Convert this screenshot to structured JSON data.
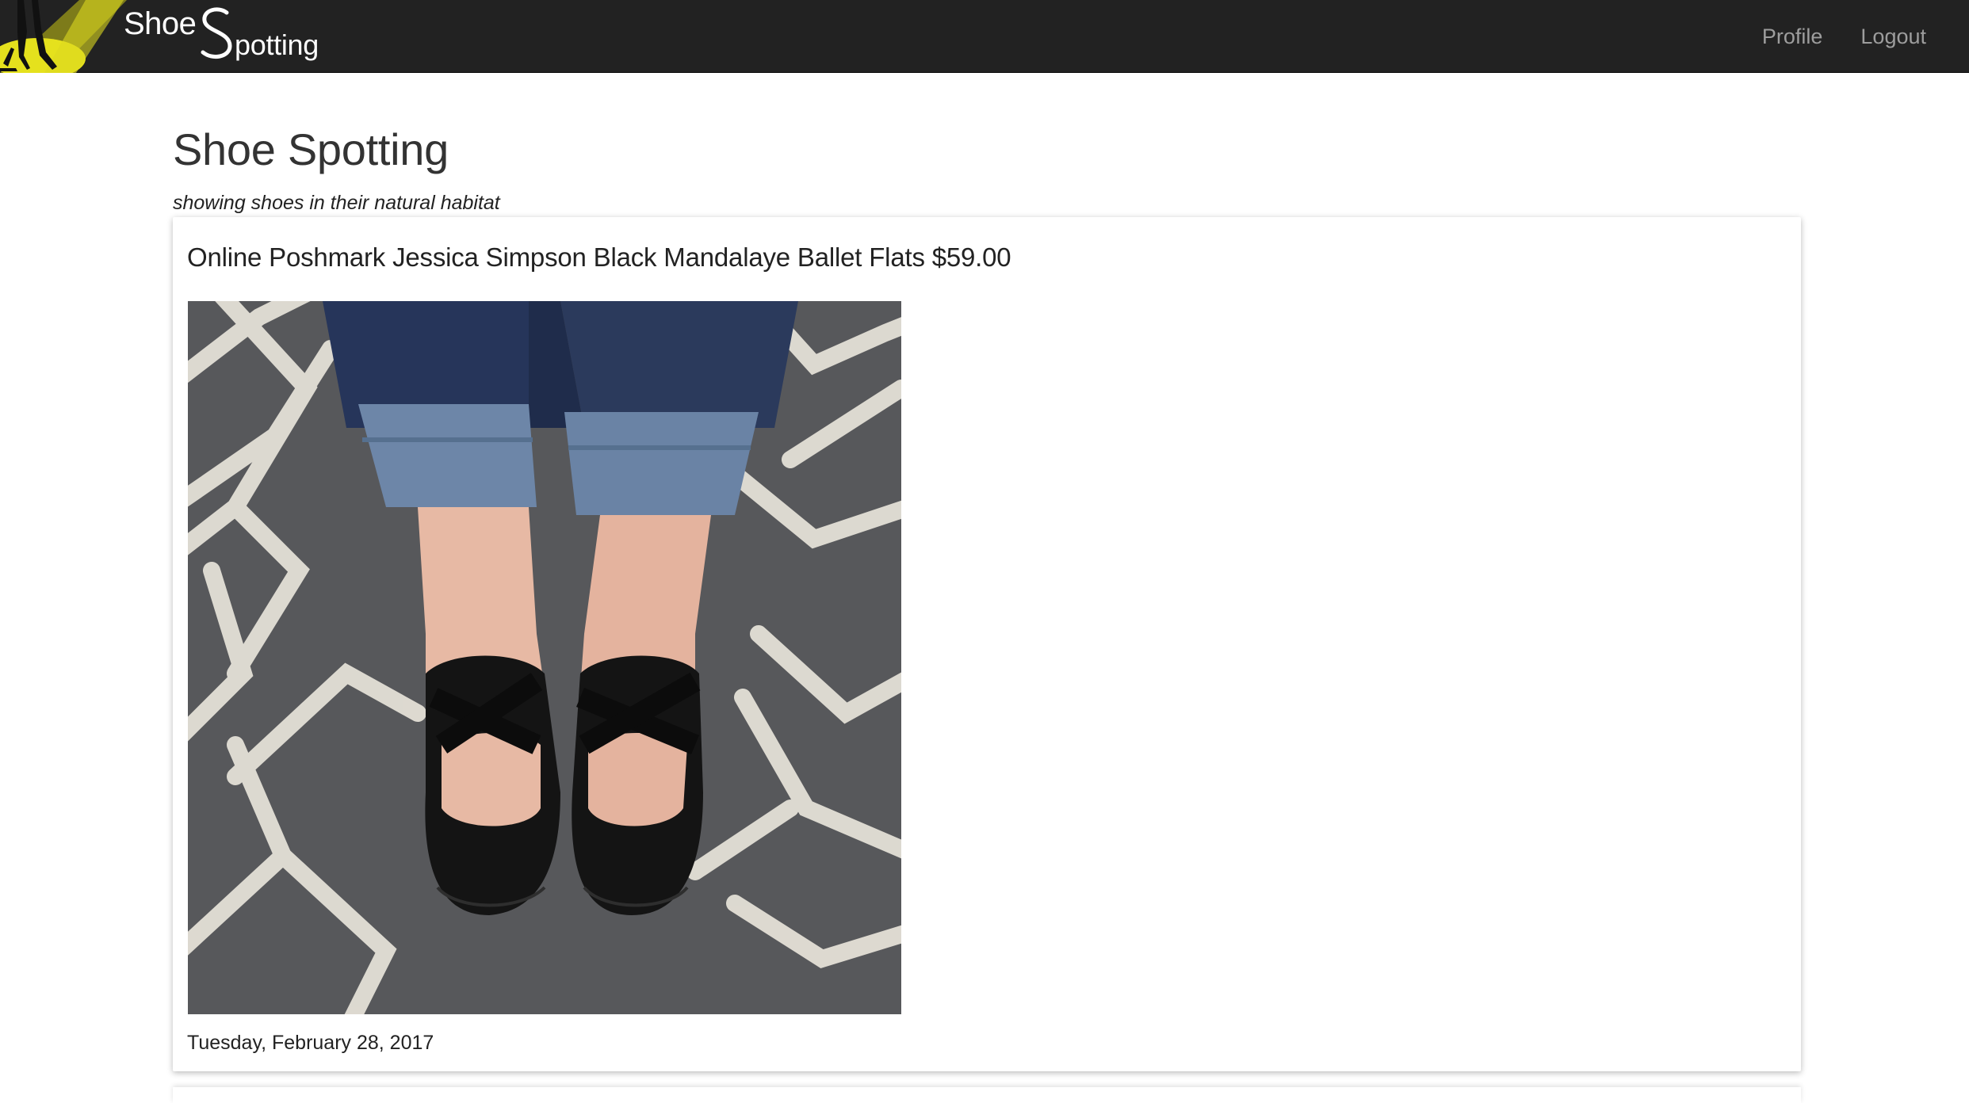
{
  "navbar": {
    "brand": {
      "word_shoe": "Shoe",
      "word_potting": "potting"
    },
    "links": [
      {
        "label": "Profile"
      },
      {
        "label": "Logout"
      }
    ]
  },
  "header": {
    "title": "Shoe Spotting",
    "subtitle": "showing shoes in their natural habitat"
  },
  "posts": [
    {
      "title": "Online Poshmark Jessica Simpson Black Mandalaye Ballet Flats $59.00",
      "date": "Tuesday, February 28, 2017"
    }
  ],
  "colors": {
    "navbar_bg": "#222222",
    "nav_link": "#9d9d9d",
    "logo_spotlight": "#e5e11d",
    "rug_dark": "#57585b",
    "rug_lines": "#e8e4da",
    "jeans": "#2b3a5c",
    "jeans_cuff": "#6d86a8",
    "shoe": "#141414",
    "skin": "#e7b9a4"
  },
  "icons": {
    "logo": "spotlight-silhouette-logo",
    "brand_letter": "stylized-s-icon"
  }
}
